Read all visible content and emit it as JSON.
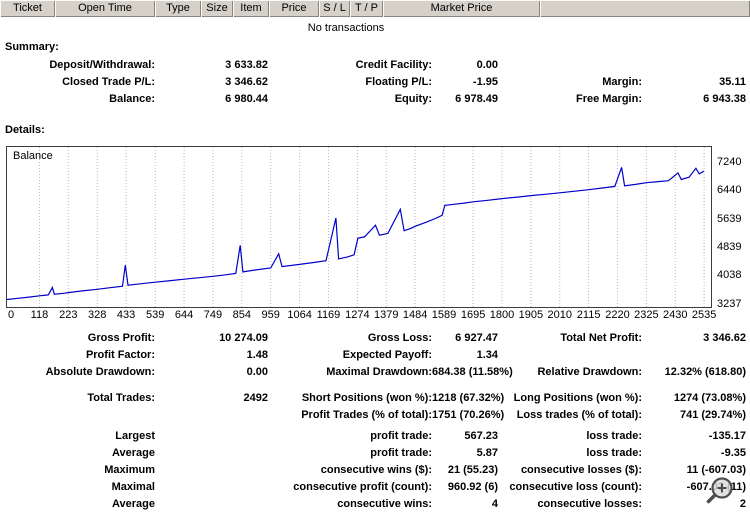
{
  "table_header": {
    "columns": [
      {
        "id": "ticket",
        "label": "Ticket"
      },
      {
        "id": "open-time",
        "label": "Open Time"
      },
      {
        "id": "type",
        "label": "Type"
      },
      {
        "id": "size",
        "label": "Size"
      },
      {
        "id": "item",
        "label": "Item"
      },
      {
        "id": "price",
        "label": "Price"
      },
      {
        "id": "sl",
        "label": "S / L"
      },
      {
        "id": "tp",
        "label": "T / P"
      },
      {
        "id": "market-price",
        "label": "Market Price"
      }
    ]
  },
  "transactions_empty": "No transactions",
  "summary": {
    "title": "Summary:",
    "rows": [
      [
        "Deposit/Withdrawal:",
        "3 633.82",
        "Credit Facility:",
        "0.00",
        "",
        ""
      ],
      [
        "Closed Trade P/L:",
        "3 346.62",
        "Floating P/L:",
        "-1.95",
        "Margin:",
        "35.11"
      ],
      [
        "Balance:",
        "6 980.44",
        "Equity:",
        "6 978.49",
        "Free Margin:",
        "6 943.38"
      ]
    ]
  },
  "details": {
    "title": "Details:"
  },
  "chart_data": {
    "type": "line",
    "title": "Balance",
    "xlabel": "",
    "ylabel": "",
    "x_ticks": [
      0,
      118,
      223,
      328,
      433,
      539,
      644,
      749,
      854,
      959,
      1064,
      1169,
      1274,
      1379,
      1484,
      1589,
      1695,
      1800,
      1905,
      2010,
      2115,
      2220,
      2325,
      2430,
      2535
    ],
    "y_ticks": [
      7240,
      6440,
      5639,
      4839,
      4038,
      3237
    ],
    "xlim": [
      0,
      2560
    ],
    "ylim": [
      3237,
      7240
    ],
    "grid": "vertical-dashed",
    "legend_position": "top-left-label",
    "line_color": "#0000cc",
    "grid_color": "#b8b8b8",
    "series": [
      {
        "name": "Balance",
        "points": [
          [
            0,
            3360
          ],
          [
            40,
            3395
          ],
          [
            80,
            3430
          ],
          [
            118,
            3465
          ],
          [
            150,
            3490
          ],
          [
            165,
            3700
          ],
          [
            172,
            3510
          ],
          [
            210,
            3540
          ],
          [
            223,
            3555
          ],
          [
            270,
            3600
          ],
          [
            328,
            3650
          ],
          [
            375,
            3695
          ],
          [
            420,
            3735
          ],
          [
            430,
            4330
          ],
          [
            440,
            3765
          ],
          [
            485,
            3805
          ],
          [
            539,
            3850
          ],
          [
            595,
            3895
          ],
          [
            644,
            3935
          ],
          [
            700,
            3975
          ],
          [
            749,
            4015
          ],
          [
            800,
            4060
          ],
          [
            832,
            4100
          ],
          [
            848,
            4890
          ],
          [
            858,
            4140
          ],
          [
            905,
            4195
          ],
          [
            959,
            4250
          ],
          [
            988,
            4650
          ],
          [
            1000,
            4290
          ],
          [
            1064,
            4350
          ],
          [
            1115,
            4405
          ],
          [
            1160,
            4455
          ],
          [
            1196,
            5660
          ],
          [
            1206,
            4505
          ],
          [
            1240,
            4565
          ],
          [
            1262,
            4620
          ],
          [
            1276,
            5090
          ],
          [
            1300,
            5125
          ],
          [
            1340,
            5455
          ],
          [
            1354,
            5175
          ],
          [
            1385,
            5225
          ],
          [
            1430,
            5905
          ],
          [
            1444,
            5300
          ],
          [
            1468,
            5365
          ],
          [
            1484,
            5425
          ],
          [
            1522,
            5535
          ],
          [
            1558,
            5645
          ],
          [
            1582,
            5735
          ],
          [
            1592,
            6015
          ],
          [
            1625,
            6045
          ],
          [
            1662,
            6080
          ],
          [
            1695,
            6115
          ],
          [
            1752,
            6160
          ],
          [
            1800,
            6205
          ],
          [
            1860,
            6250
          ],
          [
            1905,
            6290
          ],
          [
            1962,
            6330
          ],
          [
            2010,
            6370
          ],
          [
            2065,
            6415
          ],
          [
            2115,
            6455
          ],
          [
            2165,
            6505
          ],
          [
            2210,
            6550
          ],
          [
            2235,
            7085
          ],
          [
            2246,
            6565
          ],
          [
            2285,
            6605
          ],
          [
            2325,
            6655
          ],
          [
            2368,
            6685
          ],
          [
            2405,
            6710
          ],
          [
            2440,
            6930
          ],
          [
            2452,
            6745
          ],
          [
            2480,
            6810
          ],
          [
            2505,
            7060
          ],
          [
            2517,
            6905
          ],
          [
            2535,
            6980
          ]
        ]
      }
    ]
  },
  "stats": {
    "rows": [
      [
        "Gross Profit:",
        "10 274.09",
        "Gross Loss:",
        "6 927.47",
        "Total Net Profit:",
        "3 346.62"
      ],
      [
        "Profit Factor:",
        "1.48",
        "Expected Payoff:",
        "1.34",
        "",
        ""
      ],
      [
        "Absolute Drawdown:",
        "0.00",
        "Maximal Drawdown:",
        "684.38 (11.58%)",
        "Relative Drawdown:",
        "12.32% (618.80)"
      ],
      [
        "Total Trades:",
        "2492",
        "Short Positions (won %):",
        "1218 (67.32%)",
        "Long Positions (won %):",
        "1274 (73.08%)"
      ],
      [
        "",
        "",
        "Profit Trades (% of total):",
        "1751 (70.26%)",
        "Loss trades (% of total):",
        "741 (29.74%)"
      ],
      [
        "Largest",
        "",
        "profit trade:",
        "567.23",
        "loss trade:",
        "-135.17"
      ],
      [
        "Average",
        "",
        "profit trade:",
        "5.87",
        "loss trade:",
        "-9.35"
      ],
      [
        "Maximum",
        "",
        "consecutive wins ($):",
        "21 (55.23)",
        "consecutive losses ($):",
        "11 (-607.03)"
      ],
      [
        "Maximal",
        "",
        "consecutive profit (count):",
        "960.92 (6)",
        "consecutive loss (count):",
        "-607.03 (11)"
      ],
      [
        "Average",
        "",
        "consecutive wins:",
        "4",
        "consecutive losses:",
        "2"
      ]
    ]
  },
  "zoom_control": {
    "type": "zoom-in"
  }
}
